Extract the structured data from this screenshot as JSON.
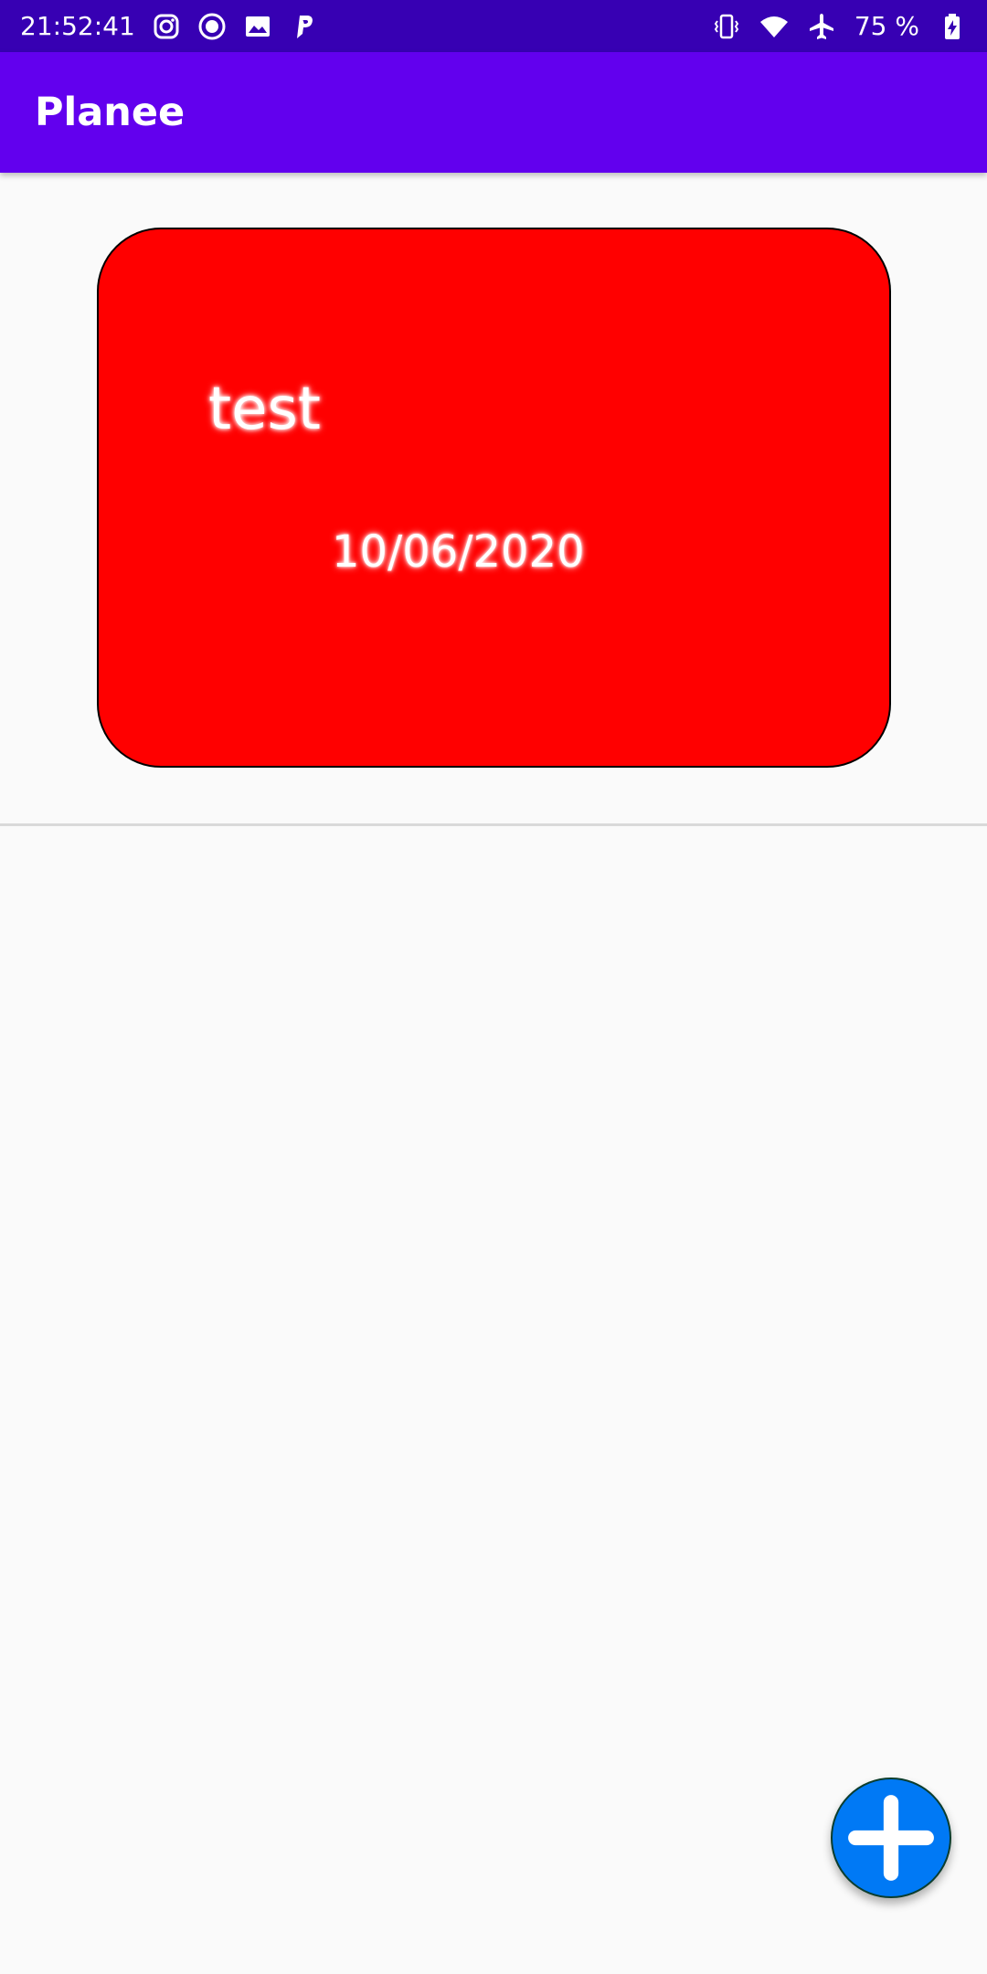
{
  "status_bar": {
    "time": "21:52:41",
    "battery": "75 %",
    "left_icons": [
      "instagram-icon",
      "record-icon",
      "image-icon",
      "paypal-icon"
    ],
    "right_icons": [
      "vibrate-icon",
      "wifi-icon",
      "airplane-icon",
      "battery-charging-icon"
    ]
  },
  "app_bar": {
    "title": "Planee",
    "color": "#6200ee"
  },
  "events": [
    {
      "title": "test",
      "date": "10/06/2020",
      "color": "#ff0000"
    }
  ],
  "fab": {
    "icon": "plus-icon",
    "color": "#0079f5"
  }
}
